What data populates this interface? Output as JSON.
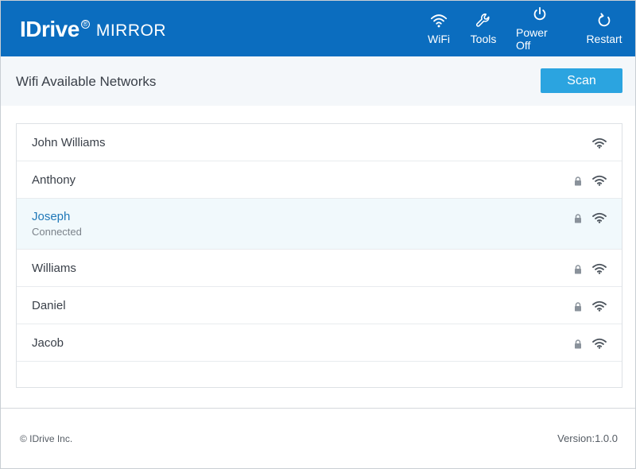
{
  "app": {
    "brand": "IDrive",
    "brand_suffix": "MIRROR",
    "registered_mark": "®"
  },
  "nav": [
    {
      "label": "WiFi",
      "icon": "wifi-icon"
    },
    {
      "label": "Tools",
      "icon": "wrench-icon"
    },
    {
      "label": "Power Off",
      "icon": "power-icon"
    },
    {
      "label": "Restart",
      "icon": "restart-icon"
    }
  ],
  "page": {
    "title": "Wifi Available Networks",
    "scan_label": "Scan"
  },
  "networks": [
    {
      "name": "John Williams",
      "secured": false,
      "status": ""
    },
    {
      "name": "Anthony",
      "secured": true,
      "status": ""
    },
    {
      "name": "Joseph",
      "secured": true,
      "status": "Connected"
    },
    {
      "name": "Williams",
      "secured": true,
      "status": ""
    },
    {
      "name": "Daniel",
      "secured": true,
      "status": ""
    },
    {
      "name": "Jacob",
      "secured": true,
      "status": ""
    }
  ],
  "footer": {
    "copyright": "© IDrive Inc.",
    "version": "Version:1.0.0"
  },
  "colors": {
    "header_bg": "#0b6dbf",
    "scan_button": "#2ba4e0",
    "connected_text": "#1f78b8",
    "connected_row_bg": "#f1f9fc"
  }
}
